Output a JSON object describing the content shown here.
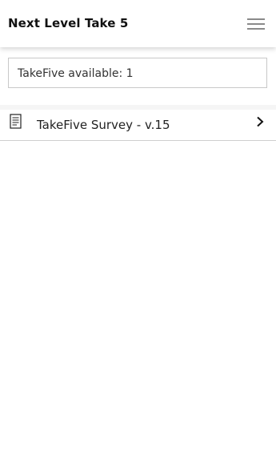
{
  "header": {
    "title": "Next Level Take 5",
    "menu_icon": "hamburger-menu-icon"
  },
  "availability": {
    "text": "TakeFive available: 1"
  },
  "surveys": [
    {
      "label": "TakeFive Survey - v.15",
      "icon": "document-icon",
      "trailing_icon": "chevron-right-icon"
    }
  ],
  "colors": {
    "background": "#ffffff",
    "section_background": "#f5f5f5",
    "border": "#c8c8c8",
    "text": "#111111",
    "menu_icon": "#8a8a8a"
  }
}
